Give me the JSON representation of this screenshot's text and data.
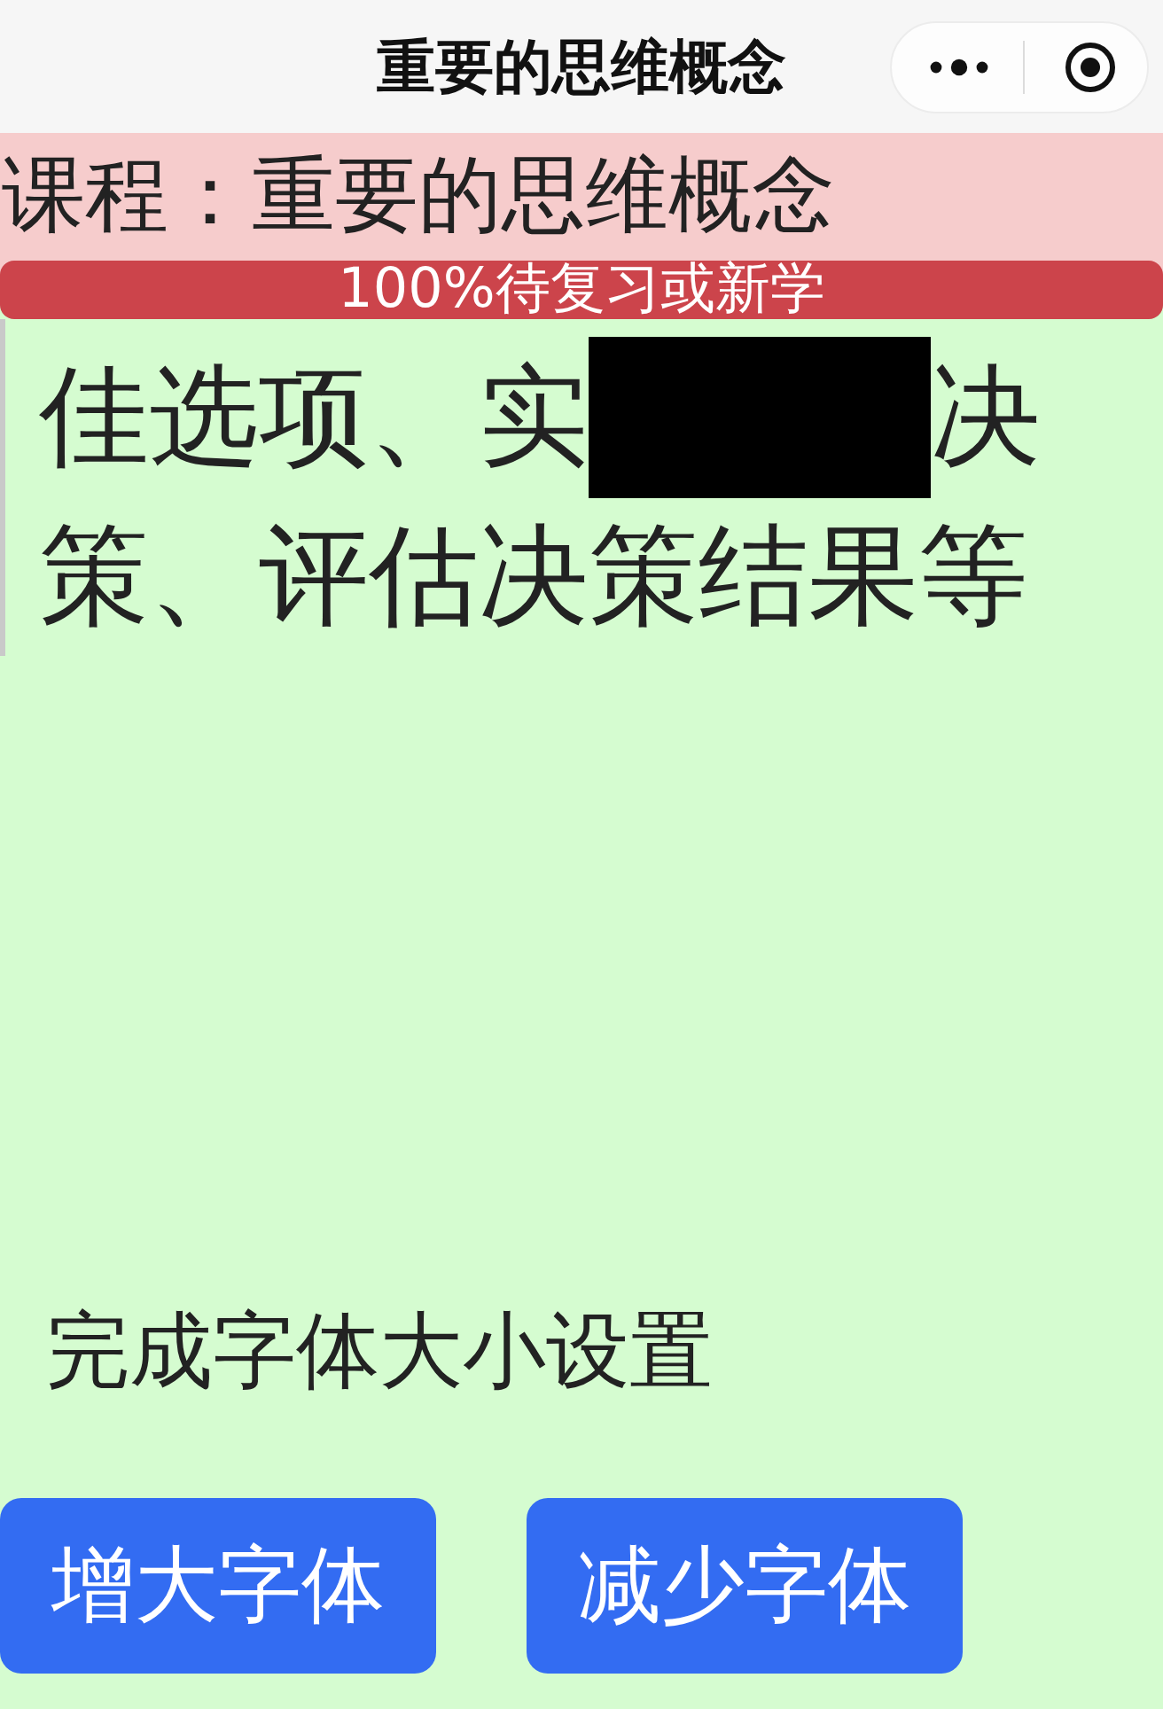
{
  "nav_bar": {
    "title": "重要的思维概念"
  },
  "course_header": {
    "label": "课程：重要的思维概念"
  },
  "progress": {
    "level": 1,
    "label": "100%待复习或新学"
  },
  "passage": {
    "lines": [
      {
        "segments": [
          {
            "kind": "text",
            "text": "佳选项、实"
          },
          {
            "kind": "redaction"
          },
          {
            "kind": "text",
            "text": "决"
          }
        ]
      },
      {
        "segments": [
          {
            "kind": "text",
            "text": "策、评估决策结果等"
          }
        ]
      }
    ]
  },
  "done_action": {
    "label": "完成字体大小设置"
  },
  "buttons": [
    {
      "label": "增大字体"
    },
    {
      "label": "减少字体"
    }
  ]
}
